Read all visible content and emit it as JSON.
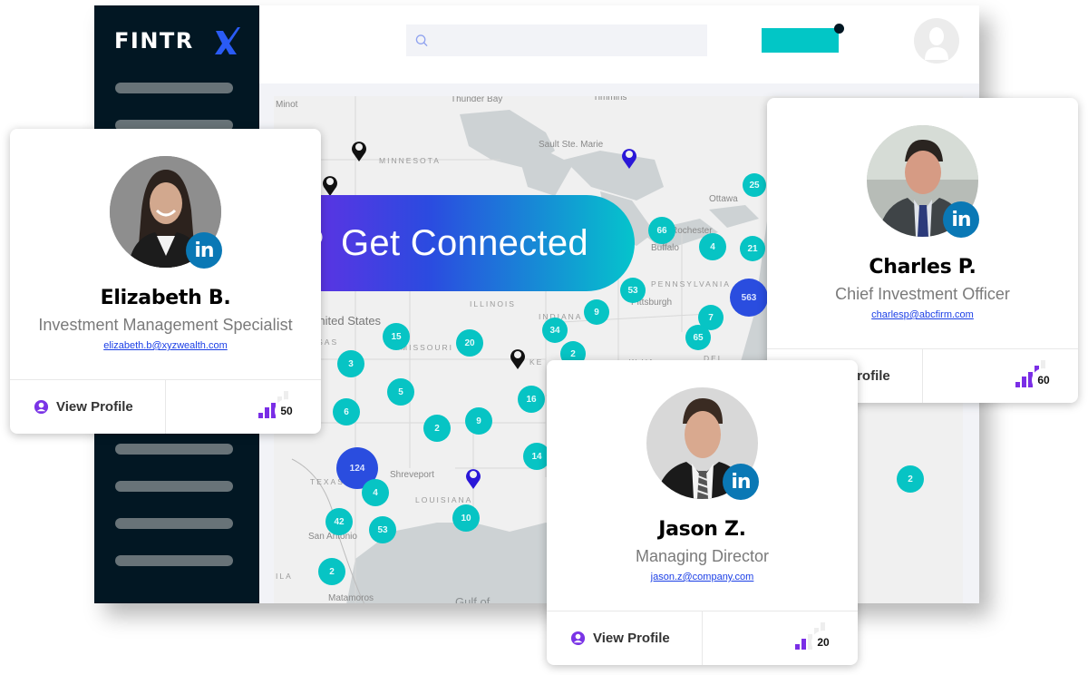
{
  "brand": {
    "logo_text": "FINTR",
    "logo_accent": "X",
    "colors": {
      "sidebar": "#021723",
      "accent_teal": "#02c6c6",
      "accent_blue": "#2a4ddf",
      "accent_purple": "#7228e4",
      "linkedin": "#0a78b5"
    }
  },
  "sidebar": {
    "items": [
      {
        "label": ""
      },
      {
        "label": ""
      },
      {
        "label": ""
      },
      {
        "label": ""
      },
      {
        "label": ""
      },
      {
        "label": ""
      }
    ]
  },
  "topbar": {
    "search": {
      "placeholder": "",
      "value": "",
      "icon": "search-icon"
    },
    "cta_label": "",
    "notification_dot": true,
    "avatar_icon": "user-avatar-icon"
  },
  "connect": {
    "label": "Get Connected",
    "icon": "link-icon"
  },
  "map": {
    "labels": {
      "minot": "Minot",
      "thunder_bay": "Thunder Bay",
      "timmins": "Timmins",
      "sault": "Sault Ste. Marie",
      "ottawa": "Ottawa",
      "minnesota": "MINNESOTA",
      "rochester": "Rochester",
      "buffalo": "Buffalo",
      "pennsylvania": "PENNSYLVANIA",
      "pittsburgh": "Pittsburgh",
      "illinois": "ILLINOIS",
      "indiana": "INDIANA",
      "missouri": "MISSOURI",
      "united_states": "United States",
      "kansas": "NSAS",
      "wva": "W.VA.",
      "del": "DEL",
      "ky": "KE",
      "texas": "TEXAS",
      "shreveport": "Shreveport",
      "louisiana": "LOUISIANA",
      "san_antonio": "San Antonio",
      "coahuila": "ILA",
      "matamoros": "Matamoros",
      "gulf": "Gulf of"
    },
    "clusters": [
      {
        "count": "25"
      },
      {
        "count": "66"
      },
      {
        "count": "4"
      },
      {
        "count": "21"
      },
      {
        "count": "53"
      },
      {
        "count": "563"
      },
      {
        "count": "9"
      },
      {
        "count": "7"
      },
      {
        "count": "65"
      },
      {
        "count": "34"
      },
      {
        "count": "2"
      },
      {
        "count": "15"
      },
      {
        "count": "20"
      },
      {
        "count": "3"
      },
      {
        "count": "5"
      },
      {
        "count": "6"
      },
      {
        "count": "2"
      },
      {
        "count": "9"
      },
      {
        "count": "16"
      },
      {
        "count": "14"
      },
      {
        "count": "124"
      },
      {
        "count": "4"
      },
      {
        "count": "42"
      },
      {
        "count": "53"
      },
      {
        "count": "10"
      },
      {
        "count": "2"
      },
      {
        "count": "2"
      }
    ]
  },
  "cards": [
    {
      "name": "Elizabeth B.",
      "title": "Investment Management Specialist",
      "email": "elizabeth.b@xyzwealth.com",
      "view_profile": "View Profile",
      "score": "50",
      "score_fraction": 0.5,
      "social": "in"
    },
    {
      "name": "Charles P.",
      "title": "Chief Investment Officer",
      "email": "charlesp@abcfirm.com",
      "view_profile": "View Profile",
      "score": "60",
      "score_fraction": 0.6,
      "social": "in"
    },
    {
      "name": "Jason Z.",
      "title": "Managing Director",
      "email": "jason.z@company.com",
      "view_profile": "View Profile",
      "score": "20",
      "score_fraction": 0.2,
      "social": "in"
    }
  ]
}
